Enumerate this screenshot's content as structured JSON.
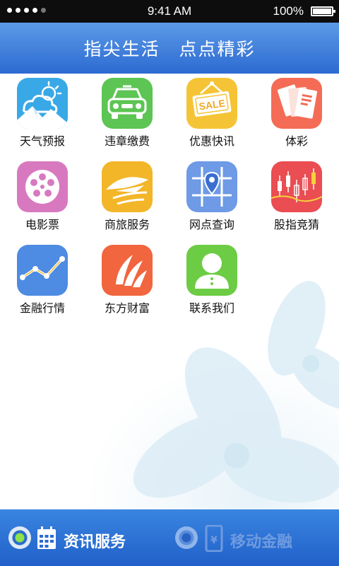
{
  "status_bar": {
    "time": "9:41 AM",
    "battery": "100%"
  },
  "header": {
    "title": "指尖生活　点点精彩"
  },
  "apps": [
    {
      "label": "天气预报",
      "icon": "weather-icon",
      "color": "#39a8e6"
    },
    {
      "label": "违章缴费",
      "icon": "car-icon",
      "color": "#5cc553"
    },
    {
      "label": "优惠快讯",
      "icon": "sale-tag-icon",
      "color": "#f5c436"
    },
    {
      "label": "体彩",
      "icon": "lottery-ticket-icon",
      "color": "#f46c56"
    },
    {
      "label": "电影票",
      "icon": "film-reel-icon",
      "color": "#d879c0"
    },
    {
      "label": "商旅服务",
      "icon": "airplane-icon",
      "color": "#f3b629"
    },
    {
      "label": "网点查询",
      "icon": "map-pin-icon",
      "color": "#6e9ae6"
    },
    {
      "label": "股指竞猜",
      "icon": "candlestick-icon",
      "color": "#ea4d52"
    },
    {
      "label": "金融行情",
      "icon": "trend-line-icon",
      "color": "#4e8be2"
    },
    {
      "label": "东方财富",
      "icon": "wing-logo-icon",
      "color": "#f1663f"
    },
    {
      "label": "联系我们",
      "icon": "contact-person-icon",
      "color": "#6ccc44"
    }
  ],
  "tabbar": {
    "tabs": [
      {
        "label": "资讯服务",
        "icon": "calendar-icon",
        "selected": true
      },
      {
        "label": "移动金融",
        "icon": "mobile-yen-icon",
        "selected": false
      }
    ]
  }
}
